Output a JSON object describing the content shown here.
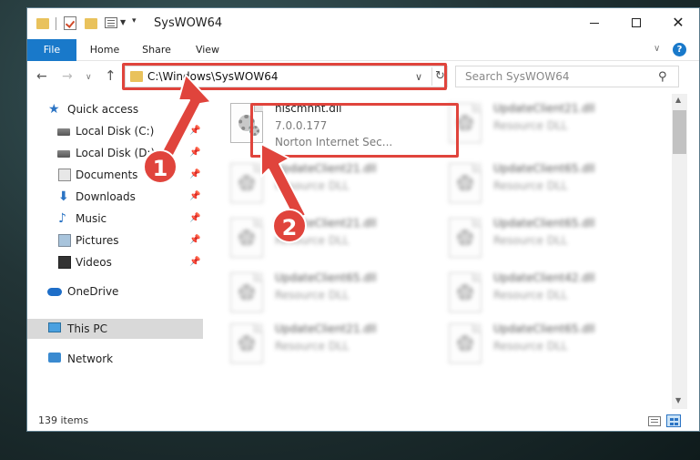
{
  "window": {
    "title": "SysWOW64"
  },
  "ribbon": {
    "tabs": [
      "File",
      "Home",
      "Share",
      "View"
    ],
    "help_label": "?"
  },
  "nav": {
    "address": "C:\\Windows\\SysWOW64",
    "search_placeholder": "Search SysWOW64"
  },
  "sidebar": {
    "items": [
      {
        "label": "Quick access",
        "icon": "star-icon"
      },
      {
        "label": "Local Disk (C:)",
        "icon": "drive-icon",
        "pinned": true
      },
      {
        "label": "Local Disk (D:)",
        "icon": "drive-icon",
        "pinned": true
      },
      {
        "label": "Documents",
        "icon": "documents-icon",
        "pinned": true
      },
      {
        "label": "Downloads",
        "icon": "download-icon",
        "pinned": true
      },
      {
        "label": "Music",
        "icon": "music-icon",
        "pinned": true
      },
      {
        "label": "Pictures",
        "icon": "pictures-icon",
        "pinned": true
      },
      {
        "label": "Videos",
        "icon": "videos-icon",
        "pinned": true
      },
      {
        "label": "OneDrive",
        "icon": "onedrive-icon"
      },
      {
        "label": "This PC",
        "icon": "pc-icon",
        "selected": true
      },
      {
        "label": "Network",
        "icon": "network-icon"
      }
    ]
  },
  "files": [
    {
      "name": "niscmnht.dll",
      "line1": "7.0.0.177",
      "line2": "Norton Internet Sec...",
      "highlighted": true
    },
    {
      "name": "UpdateClient21.dll",
      "line1": "Resource DLL"
    },
    {
      "name": "UpdateClient21.dll",
      "line1": "Resource DLL"
    },
    {
      "name": "UpdateClient65.dll",
      "line1": "Resource DLL"
    },
    {
      "name": "UpdateClient21.dll",
      "line1": "Resource DLL"
    },
    {
      "name": "UpdateClient65.dll",
      "line1": "Resource DLL"
    },
    {
      "name": "UpdateClient65.dll",
      "line1": "Resource DLL"
    },
    {
      "name": "UpdateClient42.dll",
      "line1": "Resource DLL"
    },
    {
      "name": "UpdateClient21.dll",
      "line1": "Resource DLL"
    },
    {
      "name": "UpdateClient65.dll",
      "line1": "Resource DLL"
    }
  ],
  "status": {
    "item_count": "139 items"
  },
  "annotations": {
    "badge_1": "1",
    "badge_2": "2",
    "color": "#e0443c"
  },
  "colors": {
    "accent": "#1979ca",
    "annotation": "#e0443c"
  }
}
